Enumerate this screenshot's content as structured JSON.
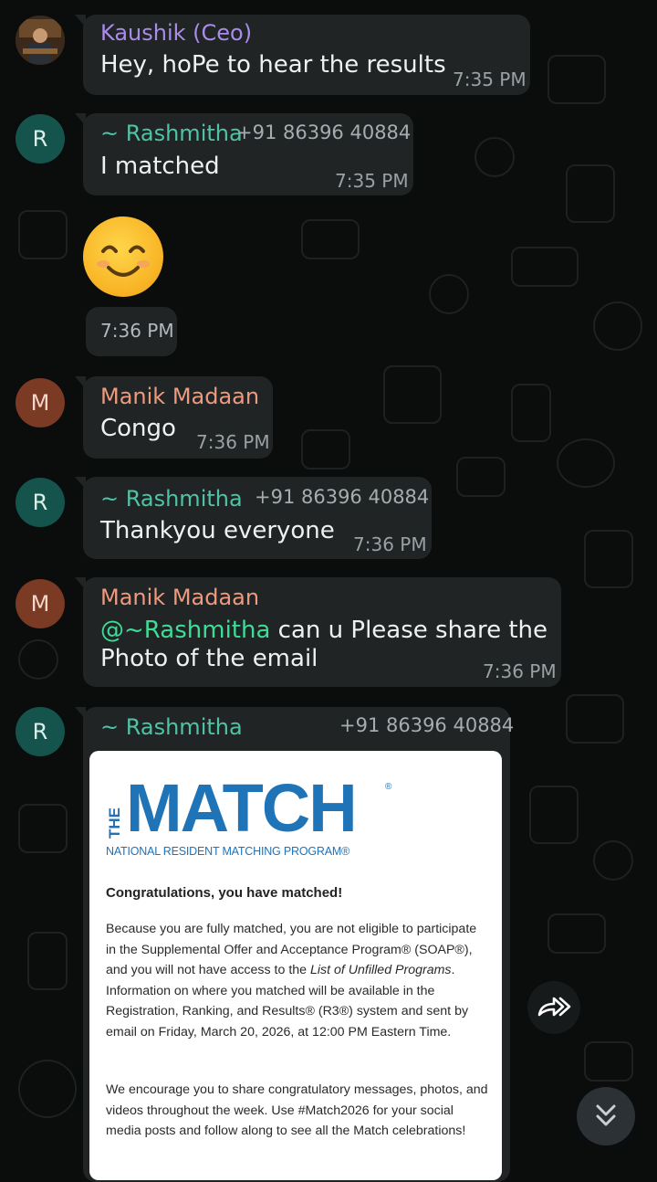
{
  "messages": [
    {
      "sender": "Kaushik (Ceo)",
      "text": "Hey, hoPe to hear the results",
      "time": "7:35 PM"
    },
    {
      "avatar": "R",
      "sender": "~ Rashmitha",
      "phone": "+91 86396 40884",
      "text": "I matched",
      "time": "7:35 PM"
    },
    {
      "emoji": "smiling-face-emoji",
      "time": "7:36 PM"
    },
    {
      "avatar": "M",
      "sender": "Manik Madaan",
      "text": "Congo",
      "time": "7:36 PM"
    },
    {
      "avatar": "R",
      "sender": "~ Rashmitha",
      "phone": "+91 86396 40884",
      "text": "Thankyou everyone",
      "time": "7:36 PM"
    },
    {
      "avatar": "M",
      "sender": "Manik Madaan",
      "mention": "@~Rashmitha",
      "text_line1": " can u Please share the",
      "text_line2": "Photo of the email",
      "time": "7:36 PM"
    },
    {
      "avatar": "R",
      "sender": "~ Rashmitha",
      "phone": "+91 86396 40884"
    }
  ],
  "email": {
    "logo_the": "THE",
    "logo_match": "MATCH",
    "logo_reg": "®",
    "logo_subtitle": "NATIONAL RESIDENT MATCHING PROGRAM®",
    "title": "Congratulations, you have matched!",
    "para1_a": "Because you are fully matched, you are not eligible to participate in the Supplemental Offer and Acceptance Program® (SOAP®), and you will not have access to the ",
    "para1_italic": "List of Unfilled Programs",
    "para1_b": ". Information on where you matched will be available in the Registration, Ranking, and Results® (R3®) system and sent by email on Friday, March 20, 2026, at 12:00 PM Eastern Time.",
    "para2": "We encourage you to share congratulatory messages, photos, and videos throughout the week. Use #Match2026 for your social media posts and follow along to see all the Match celebrations!"
  },
  "buttons": {
    "forward_icon": "forward-icon",
    "scroll_down_icon": "chevron-double-down-icon"
  },
  "colors": {
    "background": "#0b0c0c",
    "bubble": "#202425",
    "kaushik_name": "#a98bea",
    "rashmitha_name": "#4fc3a5",
    "manik_name": "#ee9a7e",
    "mention": "#3ddc97",
    "match_blue": "#1f73b7"
  }
}
